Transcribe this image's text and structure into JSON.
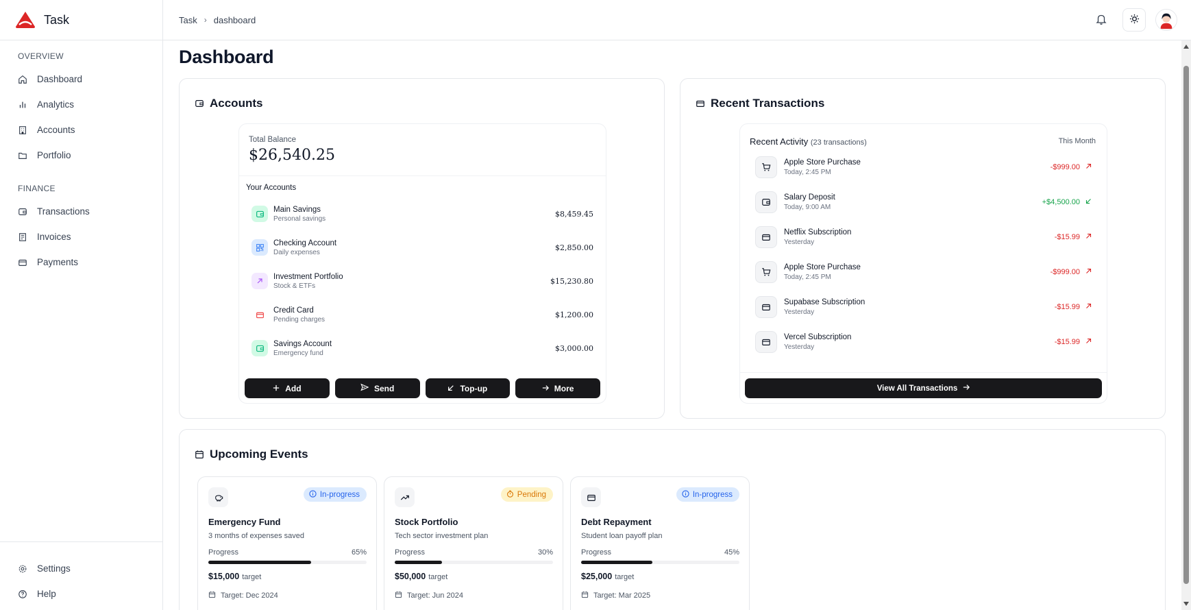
{
  "app": {
    "name": "Task",
    "brand_color": "#dc2626"
  },
  "breadcrumb": {
    "root": "Task",
    "current": "dashboard"
  },
  "sidebar": {
    "sections": [
      {
        "label": "OVERVIEW",
        "items": [
          {
            "label": "Dashboard",
            "icon": "home-icon"
          },
          {
            "label": "Analytics",
            "icon": "bar-chart-icon"
          },
          {
            "label": "Accounts",
            "icon": "building-icon"
          },
          {
            "label": "Portfolio",
            "icon": "folder-icon"
          }
        ]
      },
      {
        "label": "FINANCE",
        "items": [
          {
            "label": "Transactions",
            "icon": "wallet-icon"
          },
          {
            "label": "Invoices",
            "icon": "receipt-icon"
          },
          {
            "label": "Payments",
            "icon": "credit-card-icon"
          }
        ]
      }
    ],
    "bottom": [
      {
        "label": "Settings",
        "icon": "gear-icon"
      },
      {
        "label": "Help",
        "icon": "help-circle-icon"
      }
    ]
  },
  "page": {
    "title": "Dashboard"
  },
  "accounts": {
    "title": "Accounts",
    "total_label": "Total Balance",
    "total_value": "$26,540.25",
    "your_accounts_label": "Your Accounts",
    "items": [
      {
        "name": "Main Savings",
        "sub": "Personal savings",
        "amount": "$8,459.45",
        "icon": "wallet-icon",
        "color": "#10b981"
      },
      {
        "name": "Checking Account",
        "sub": "Daily expenses",
        "amount": "$2,850.00",
        "icon": "qr-code-icon",
        "color": "#3b82f6"
      },
      {
        "name": "Investment Portfolio",
        "sub": "Stock & ETFs",
        "amount": "$15,230.80",
        "icon": "arrow-up-right-icon",
        "color": "#a855f7"
      },
      {
        "name": "Credit Card",
        "sub": "Pending charges",
        "amount": "$1,200.00",
        "icon": "credit-card-icon",
        "color": "#ef4444"
      },
      {
        "name": "Savings Account",
        "sub": "Emergency fund",
        "amount": "$3,000.00",
        "icon": "wallet-icon",
        "color": "#10b981"
      }
    ],
    "buttons": {
      "add": "Add",
      "send": "Send",
      "topup": "Top-up",
      "more": "More"
    }
  },
  "transactions": {
    "title": "Recent Transactions",
    "activity_label": "Recent Activity",
    "activity_count": "(23 transactions)",
    "period": "This Month",
    "items": [
      {
        "name": "Apple Store Purchase",
        "time": "Today, 2:45 PM",
        "amount": "-$999.00",
        "type": "out",
        "icon": "cart-icon"
      },
      {
        "name": "Salary Deposit",
        "time": "Today, 9:00 AM",
        "amount": "+$4,500.00",
        "type": "in",
        "icon": "wallet-icon"
      },
      {
        "name": "Netflix Subscription",
        "time": "Yesterday",
        "amount": "-$15.99",
        "type": "out",
        "icon": "credit-card-icon"
      },
      {
        "name": "Apple Store Purchase",
        "time": "Today, 2:45 PM",
        "amount": "-$999.00",
        "type": "out",
        "icon": "cart-icon"
      },
      {
        "name": "Supabase Subscription",
        "time": "Yesterday",
        "amount": "-$15.99",
        "type": "out",
        "icon": "credit-card-icon"
      },
      {
        "name": "Vercel Subscription",
        "time": "Yesterday",
        "amount": "-$15.99",
        "type": "out",
        "icon": "credit-card-icon"
      }
    ],
    "view_all": "View All Transactions"
  },
  "events": {
    "title": "Upcoming Events",
    "progress_label": "Progress",
    "target_suffix": "target",
    "items": [
      {
        "title": "Emergency Fund",
        "desc": "3 months of expenses saved",
        "status": "In-progress",
        "progress_text": "65%",
        "progress": 0.65,
        "target": "$15,000",
        "date": "Target: Dec 2024",
        "icon": "piggy-bank-icon"
      },
      {
        "title": "Stock Portfolio",
        "desc": "Tech sector investment plan",
        "status": "Pending",
        "progress_text": "30%",
        "progress": 0.3,
        "target": "$50,000",
        "date": "Target: Jun 2024",
        "icon": "trending-up-icon"
      },
      {
        "title": "Debt Repayment",
        "desc": "Student loan payoff plan",
        "status": "In-progress",
        "progress_text": "45%",
        "progress": 0.45,
        "target": "$25,000",
        "date": "Target: Mar 2025",
        "icon": "credit-card-icon"
      }
    ]
  }
}
